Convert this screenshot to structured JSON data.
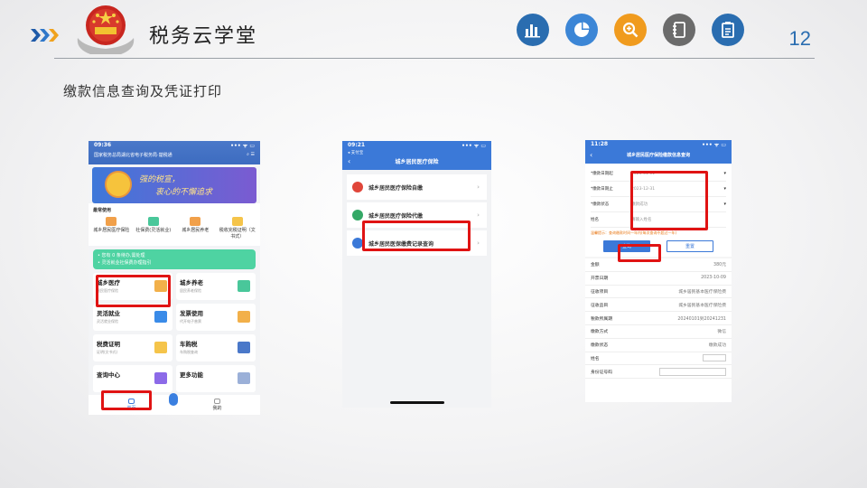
{
  "header": {
    "brand": "税务云学堂",
    "page_number": "12",
    "subtitle": "缴款信息查询及凭证打印",
    "icons": [
      {
        "name": "bar-chart-icon",
        "color": "#2a6db0"
      },
      {
        "name": "pie-chart-icon",
        "color": "#3c86d6"
      },
      {
        "name": "magnifier-icon",
        "color": "#f09b1e"
      },
      {
        "name": "notebook-icon",
        "color": "#6b6b6b"
      },
      {
        "name": "checklist-icon",
        "color": "#2a6db0"
      }
    ]
  },
  "phone1": {
    "time": "09:36",
    "status": "••• ᯤ ▭",
    "nav_title": "国家税务总局湖北省电子税务局·楚税通",
    "banner_line1": "强的税宣，",
    "banner_line2": "衷心的不懈追求",
    "section": "最常使用",
    "quick": [
      {
        "label": "城乡居民医疗保险"
      },
      {
        "label": "社保费(灵活就业)"
      },
      {
        "label": "城乡居民养老"
      },
      {
        "label": "税收完税证明（文书式）"
      }
    ],
    "notice_line1": "• 您有 0 条待办,需处理",
    "notice_line2": "• 灵活就业社保费办理指引",
    "cells": [
      {
        "name": "城乡医疗",
        "sub": "居民医疗保险",
        "color": "#f2b04a"
      },
      {
        "name": "城乡养老",
        "sub": "居民养老保险",
        "color": "#49c79a"
      },
      {
        "name": "灵活就业",
        "sub": "灵活就业保险",
        "color": "#3a8be8"
      },
      {
        "name": "发票使用",
        "sub": "代开电子普票",
        "color": "#f2b04a"
      },
      {
        "name": "税费证明",
        "sub": "证明(文书式)",
        "color": "#f5c44a"
      },
      {
        "name": "车购税",
        "sub": "车购税查询",
        "color": "#4a78c9"
      },
      {
        "name": "查询中心",
        "sub": "",
        "color": "#8c6ae8"
      },
      {
        "name": "更多功能",
        "sub": "",
        "color": "#9bb0d8"
      }
    ],
    "tab_home": "首页",
    "tab_mine": "我的"
  },
  "phone2": {
    "time": "09:21",
    "back_app": "◂ 支付宝",
    "title": "城乡居民医疗保险",
    "rows": [
      {
        "label": "城乡居民医疗保险自缴",
        "color": "#e0463a"
      },
      {
        "label": "城乡居民医疗保险代缴",
        "color": "#34a866"
      },
      {
        "label": "城乡居民医保缴费记录查询",
        "color": "#3b79d8"
      }
    ]
  },
  "phone3": {
    "time": "11:28",
    "title": "城乡居民医疗保险缴款信息查询",
    "form": [
      {
        "label": "*缴款日期起",
        "value": "2023-01-01"
      },
      {
        "label": "*缴款日期止",
        "value": "2023-12-31"
      },
      {
        "label": "*缴款状态",
        "value": "缴款成功"
      },
      {
        "label": "姓名",
        "value": "请输入姓名"
      }
    ],
    "warning": "温馨提示：查询缴款时间一年内(每次查询不超过一年)",
    "query_btn": "查询",
    "reset_btn": "重置",
    "results": [
      {
        "k": "金额",
        "v": "380元"
      },
      {
        "k": "开票日期",
        "v": "2023-10-09"
      },
      {
        "k": "征收项目",
        "v": "城乡居民基本医疗保险费"
      },
      {
        "k": "征收品目",
        "v": "城乡居民基本医疗保险费"
      },
      {
        "k": "税款所属期",
        "v": "20240101到20241231"
      },
      {
        "k": "缴款方式",
        "v": "微信"
      },
      {
        "k": "缴款状态",
        "v": "缴款成功"
      },
      {
        "k": "姓名",
        "v": ""
      },
      {
        "k": "身份证号码",
        "v": ""
      }
    ]
  }
}
